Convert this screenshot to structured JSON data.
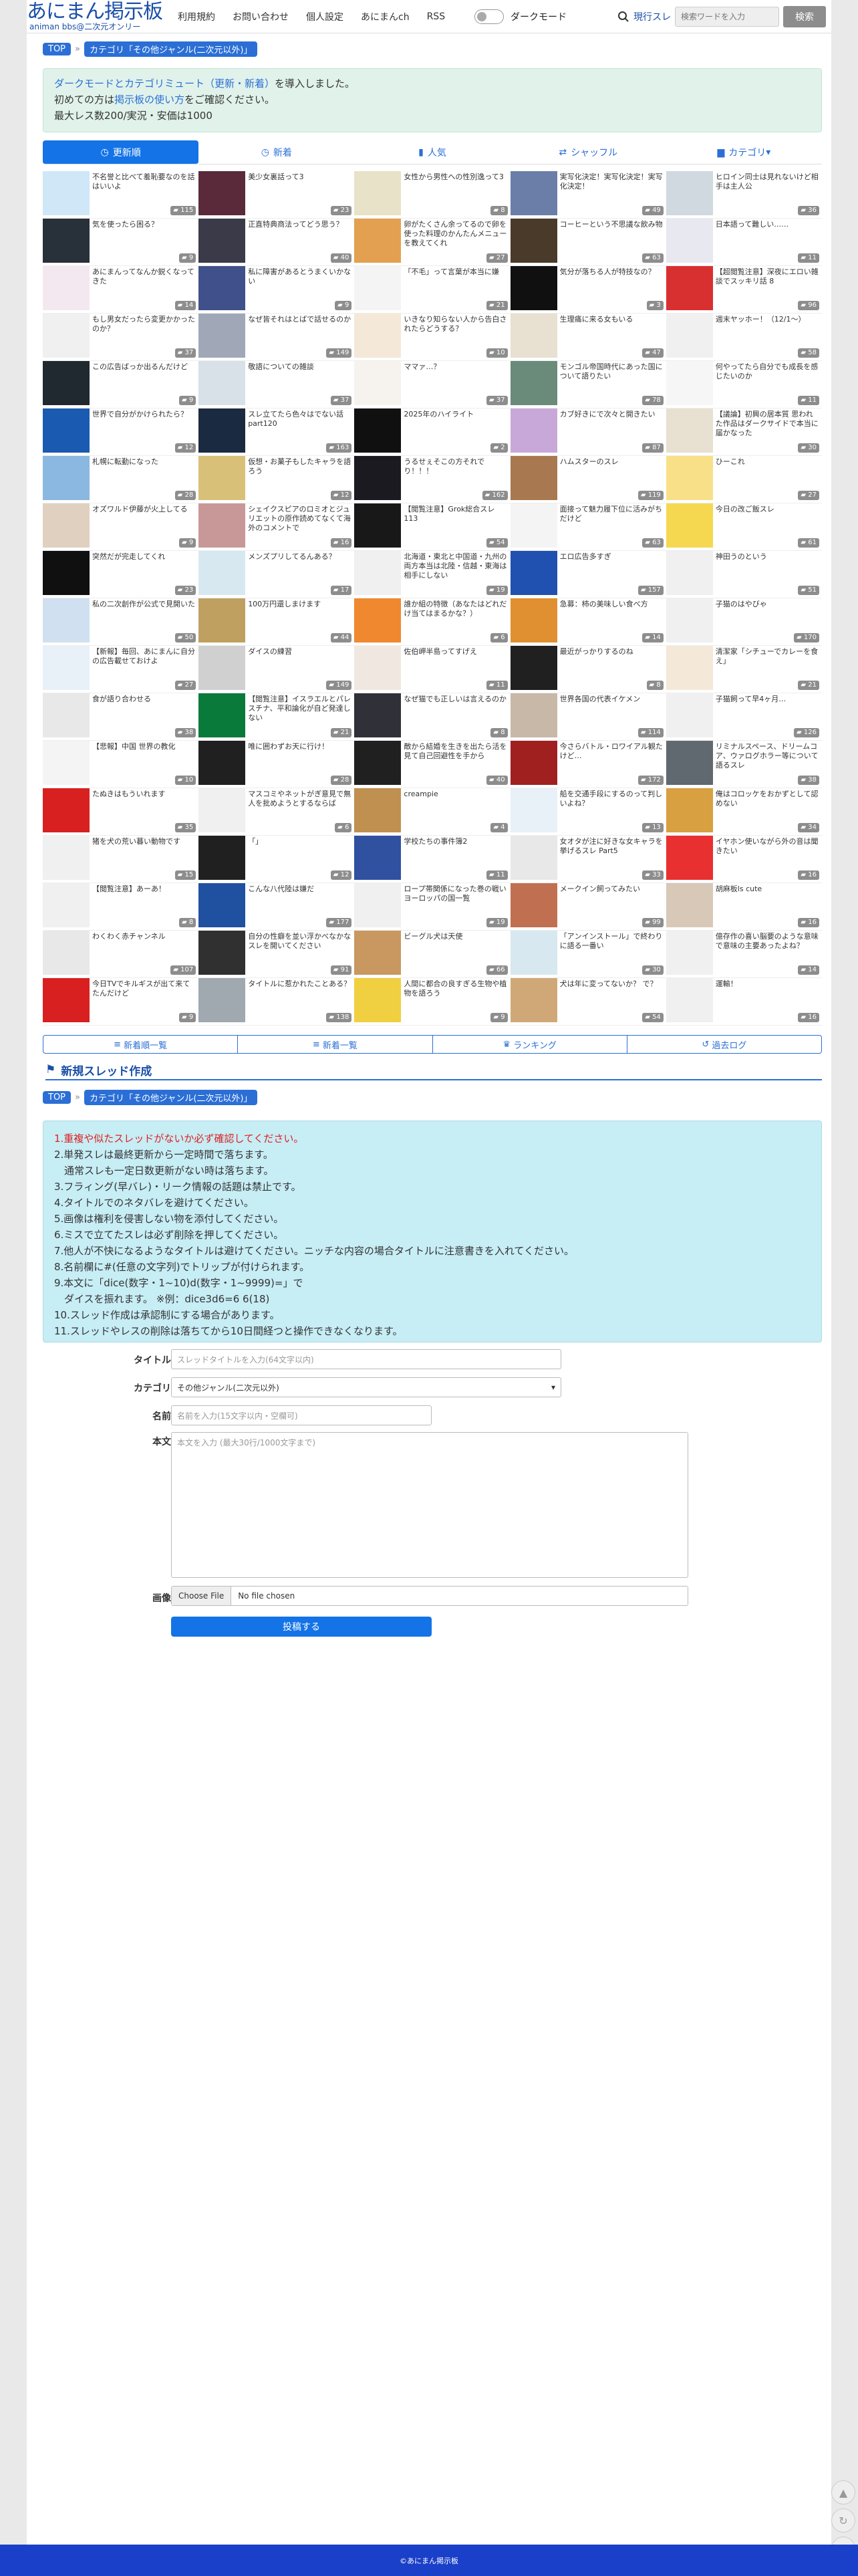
{
  "header": {
    "logo_main": "あにまん掲示板",
    "logo_sub": "animan bbs@二次元オンリー",
    "nav": [
      "利用規約",
      "お問い合わせ",
      "個人設定",
      "あにまんch",
      "RSS"
    ],
    "dark_mode_label": "ダークモード",
    "search_type": "現行スレ",
    "search_placeholder": "検索ワードを入力",
    "search_button": "検索"
  },
  "breadcrumb": {
    "top": "TOP",
    "category": "カテゴリ「その他ジャンル(二次元以外)」"
  },
  "notice": {
    "line1_link": "ダークモードとカテゴリミュート（更新・新着）",
    "line1_rest": "を導入しました。",
    "line2_pre": "初めての方は",
    "line2_link": "掲示板の使い方",
    "line2_post": "をご確認ください。",
    "line3": "最大レス数200/実況・安価は1000"
  },
  "tabs": [
    {
      "label": "更新順",
      "icon": "clock-icon"
    },
    {
      "label": "新着",
      "icon": "clock-icon"
    },
    {
      "label": "人気",
      "icon": "bar-chart-icon"
    },
    {
      "label": "シャッフル",
      "icon": "shuffle-icon"
    },
    {
      "label": "カテゴリ",
      "icon": "folder-icon"
    }
  ],
  "threads": [
    {
      "title": "不名誉と比べて羞恥要なのを話はいいよ",
      "count": "115",
      "color": "#cfe7f7"
    },
    {
      "title": "美少女裏話って3",
      "count": "23",
      "color": "#5a2a3a"
    },
    {
      "title": "女性から男性への性別逸って3",
      "count": "8",
      "color": "#e8e2c8"
    },
    {
      "title": "実写化決定！実写化決定！実写化決定！",
      "count": "49",
      "color": "#6a7ea8"
    },
    {
      "title": "ヒロイン同士は見れないけど相手は主人公",
      "count": "36",
      "color": "#d0d8e0"
    },
    {
      "title": "気を使ったら困る？",
      "count": "9",
      "color": "#28303a"
    },
    {
      "title": "正直特典商法ってどう思う？",
      "count": "40",
      "color": "#3a3a48"
    },
    {
      "title": "卵がたくさん余ってるので卵を使った料理のかんたんメニューを教えてくれ",
      "count": "27",
      "color": "#e3a050"
    },
    {
      "title": "コーヒーという不思議な飲み物",
      "count": "63",
      "color": "#4a3a2a"
    },
    {
      "title": "日本語って難しい……",
      "count": "11",
      "color": "#e8e8f0"
    },
    {
      "title": "あにまんってなんか鋭くなってきた",
      "count": "14",
      "color": "#f4e8f0"
    },
    {
      "title": "私に障害があるとうまくいかない",
      "count": "9",
      "color": "#40508a"
    },
    {
      "title": "「不毛」って言葉が本当に嫌",
      "count": "21",
      "color": "#f4f4f4"
    },
    {
      "title": "気分が落ちる人が特技なの？",
      "count": "3",
      "color": "#101010"
    },
    {
      "title": "【超閲覧注意】深夜にエロい雑談でスッキリ話 8",
      "count": "96",
      "color": "#d83030"
    },
    {
      "title": "もし男女だったら変更かかったのか？",
      "count": "37",
      "color": "#f0f0f0"
    },
    {
      "title": "なぜ皆それはとばで話せるのか",
      "count": "149",
      "color": "#a0a8b8"
    },
    {
      "title": "いきなり知らない人から告白されたらどうする？",
      "count": "10",
      "color": "#f4e8d8"
    },
    {
      "title": "生理痛に来る女もいる",
      "count": "47",
      "color": "#e8e0d0"
    },
    {
      "title": "週末ヤッホー！（12/1～）",
      "count": "58",
      "color": "#f0f0f0"
    },
    {
      "title": "この広告ばっか出るんだけど",
      "count": "9",
      "color": "#202830"
    },
    {
      "title": "敬語についての雑談",
      "count": "37",
      "color": "#d8e0e8"
    },
    {
      "title": "ママァ…？",
      "count": "37",
      "color": "#f6f2ee"
    },
    {
      "title": "モンゴル帝国時代にあった国について語りたい",
      "count": "78",
      "color": "#6a8a7a"
    },
    {
      "title": "何やってたら自分でも成長を感じたいのか",
      "count": "11",
      "color": "#f6f6f6"
    },
    {
      "title": "世界で自分がかけられたら？",
      "count": "12",
      "color": "#1a5ab0"
    },
    {
      "title": "スレ立てたら色々はでない話 part120",
      "count": "163",
      "color": "#1a2a40"
    },
    {
      "title": "2025年のハイライト",
      "count": "2",
      "color": "#101010"
    },
    {
      "title": "カブ好きにで次々と開きたい",
      "count": "87",
      "color": "#c8a8d8"
    },
    {
      "title": "【議論】初興の居本質 思われた作品はダークサイドで本当に届かなった",
      "count": "30",
      "color": "#e8e0d0"
    },
    {
      "title": "札幌に転勤になった",
      "count": "28",
      "color": "#8ab8e0"
    },
    {
      "title": "仮想・お菓子もしたキャラを語ろう",
      "count": "12",
      "color": "#d8c078"
    },
    {
      "title": "うるせぇそこの方それでり！！！",
      "count": "162",
      "color": "#1a1a20"
    },
    {
      "title": "ハムスターのスレ",
      "count": "119",
      "color": "#a87850"
    },
    {
      "title": "ひーこれ",
      "count": "27",
      "color": "#f8e088"
    },
    {
      "title": "オズワルド伊藤が火上してる",
      "count": "9",
      "color": "#e0d0c0"
    },
    {
      "title": "シェイクスピアのロミオとジュリエットの原作読めてなくて海外のコメントで",
      "count": "16",
      "color": "#c89898"
    },
    {
      "title": "【閲覧注意】Grok総合スレ113",
      "count": "54",
      "color": "#181818"
    },
    {
      "title": "面接って魅力履下位に活みがちだけど",
      "count": "63",
      "color": "#f4f4f4"
    },
    {
      "title": "今日の改ご飯スレ",
      "count": "61",
      "color": "#f6d850"
    },
    {
      "title": "突然だが完走してくれ",
      "count": "23",
      "color": "#101010"
    },
    {
      "title": "メンズプリしてるんある？",
      "count": "17",
      "color": "#d8e8f0"
    },
    {
      "title": "北海道・東北と中国道・九州の両方本当は北陸・信越・東海は相手にしない",
      "count": "19",
      "color": "#f0f0f0"
    },
    {
      "title": "エロ広告多すぎ",
      "count": "157",
      "color": "#2050b0"
    },
    {
      "title": "神田うのという",
      "count": "51",
      "color": "#f0f0f0"
    },
    {
      "title": "私の二次創作が公式で見開いた",
      "count": "50",
      "color": "#d0e0f0"
    },
    {
      "title": "100万円還しまけます",
      "count": "44",
      "color": "#c0a060"
    },
    {
      "title": "誰か組の特徴（あなたはどれだけ当てはまるかな？）",
      "count": "6",
      "color": "#f08830"
    },
    {
      "title": "急募：柿の美味しい食べ方",
      "count": "14",
      "color": "#e09030"
    },
    {
      "title": "子猫のはやびゃ",
      "count": "170",
      "color": "#f0f0f0"
    },
    {
      "title": "【新報】毎回、あにまんに自分の広告載せておけよ",
      "count": "27",
      "color": "#e8f0f8"
    },
    {
      "title": "ダイスの練習",
      "count": "149",
      "color": "#d0d0d0"
    },
    {
      "title": "佐伯岬半島ってすげえ",
      "count": "11",
      "color": "#f0e8e0"
    },
    {
      "title": "最近がっかりするのね",
      "count": "8",
      "color": "#202020"
    },
    {
      "title": "清潔家「シチューでカレーを食え」",
      "count": "21",
      "color": "#f4e8d8"
    },
    {
      "title": "食が語り合わせる",
      "count": "38",
      "color": "#e8e8e8"
    },
    {
      "title": "【閲覧注意】イスラエルとパレスチナ、平和論化が自ど発達しない",
      "count": "21",
      "color": "#0a7a3a"
    },
    {
      "title": "なぜ猫でも正しいは言えるのか",
      "count": "8",
      "color": "#303038"
    },
    {
      "title": "世界各国の代表イケメン",
      "count": "114",
      "color": "#c8b8a8"
    },
    {
      "title": "子猫飼って早4ヶ月…",
      "count": "126",
      "color": "#f0f0f0"
    },
    {
      "title": "【悲報】中国 世界の教化",
      "count": "10",
      "color": "#f4f4f4"
    },
    {
      "title": "唯に囲わずお天に行け！",
      "count": "28",
      "color": "#202020"
    },
    {
      "title": "敵から結婚を生きを出たら活を見て自己回避性を手から",
      "count": "40",
      "color": "#202020"
    },
    {
      "title": "今さらバトル・ロワイアル観たけど…",
      "count": "172",
      "color": "#a02020"
    },
    {
      "title": "リミナルスペース、ドリームコア、ウァログホラー等について語るスレ",
      "count": "38",
      "color": "#606870"
    },
    {
      "title": "たぬきはもういれます",
      "count": "35",
      "color": "#d82020"
    },
    {
      "title": "マスコミやネットがぎ意見で無人を批めようとするならば",
      "count": "6",
      "color": "#f0f0f0"
    },
    {
      "title": "creampie",
      "count": "4",
      "color": "#c09050"
    },
    {
      "title": "船を交通手段にするのって判しいよね？",
      "count": "13",
      "color": "#e8f0f8"
    },
    {
      "title": "俺はコロッケをおかずとして認めない",
      "count": "34",
      "color": "#d8a040"
    },
    {
      "title": "猪を犬の荒い暮い動物です",
      "count": "15",
      "color": "#f0f0f0"
    },
    {
      "title": "「」",
      "count": "12",
      "color": "#202020"
    },
    {
      "title": "学校たちの事件簿2",
      "count": "11",
      "color": "#3050a0"
    },
    {
      "title": "女オタが注に好きな女キャラを挙げるスレ Part5",
      "count": "33",
      "color": "#e8e8e8"
    },
    {
      "title": "イヤホン使いながら外の音は聞きたい",
      "count": "16",
      "color": "#e83030"
    },
    {
      "title": "【閲覧注意】あーあ！",
      "count": "8",
      "color": "#f0f0f0"
    },
    {
      "title": "こんな八代陸は嫌だ",
      "count": "177",
      "color": "#2050a0"
    },
    {
      "title": "ロープ帯関係になった巻の戦いヨーロッパの国一覧",
      "count": "19",
      "color": "#f0f0f0"
    },
    {
      "title": "メークイン飼ってみたい",
      "count": "99",
      "color": "#c07050"
    },
    {
      "title": "胡麻板ls cute",
      "count": "16",
      "color": "#d8c8b8"
    },
    {
      "title": "わくわく赤チャンネル",
      "count": "107",
      "color": "#e8e8e8"
    },
    {
      "title": "自分の性癖を並い浮かべなかなスレを開いてください",
      "count": "91",
      "color": "#303030"
    },
    {
      "title": "ビーグル犬は天使",
      "count": "66",
      "color": "#c89860"
    },
    {
      "title": "「アンインストール」で終わりに語る一番い",
      "count": "30",
      "color": "#d8e8f0"
    },
    {
      "title": "億存作の喜い脳要のような意味で意味の主要あったよね？",
      "count": "14",
      "color": "#f0f0f0"
    },
    {
      "title": "今日TVでキルギスが出て来てたんだけど",
      "count": "9",
      "color": "#d82020"
    },
    {
      "title": "タイトルに惹かれたことある？",
      "count": "138",
      "color": "#a0a8b0"
    },
    {
      "title": "人間に都合の良すぎる生物や植物を語ろう",
      "count": "9",
      "color": "#f0d040"
    },
    {
      "title": "犬は年に変ってないか？ で？",
      "count": "54",
      "color": "#d0a878"
    },
    {
      "title": "運輸！",
      "count": "16",
      "color": "#f0f0f0"
    }
  ],
  "bottom_tabs": [
    {
      "label": "新着順一覧",
      "icon": "list-icon"
    },
    {
      "label": "新着一覧",
      "icon": "list-icon"
    },
    {
      "label": "ランキング",
      "icon": "trophy-icon"
    },
    {
      "label": "過去ログ",
      "icon": "history-icon"
    }
  ],
  "new_thread": {
    "heading": "新規スレッド作成",
    "rules": [
      {
        "text": "1.重複や似たスレッドがないか必ず確認してください。",
        "red": true
      },
      {
        "text": "2.単発スレは最終更新から一定時間で落ちます。",
        "red": false
      },
      {
        "text": "　通常スレも一定日数更新がない時は落ちます。",
        "red": false
      },
      {
        "text": "3.フラィング(早バレ)・リーク情報の話題は禁止です。",
        "red": false
      },
      {
        "text": "4.タイトルでのネタバレを避けてください。",
        "red": false
      },
      {
        "text": "5.画像は権利を侵害しない物を添付してください。",
        "red": false
      },
      {
        "text": "6.ミスで立てたスレは必ず削除を押してください。",
        "red": false
      },
      {
        "text": "7.他人が不快になるようなタイトルは避けてください。ニッチな内容の場合タイトルに注意書きを入れてください。",
        "red": false
      },
      {
        "text": "8.名前欄に#(任意の文字列)でトリップが付けられます。",
        "red": false
      },
      {
        "text": "9.本文に「dice(数字・1~10)d(数字・1~9999)=」で",
        "red": false
      },
      {
        "text": "　ダイスを振れます。 ※例：dice3d6=6 6(18)",
        "red": false
      },
      {
        "text": "10.スレッド作成は承認制にする場合があります。",
        "red": false
      },
      {
        "text": "11.スレッドやレスの削除は落ちてから10日間経つと操作できなくなります。",
        "red": false
      }
    ],
    "title_label": "タイトル",
    "title_placeholder": "スレッドタイトルを入力(64文字以内)",
    "category_label": "カテゴリ",
    "category_value": "その他ジャンル(二次元以外)",
    "name_label": "名前",
    "name_placeholder": "名前を入力(15文字以内・空欄可)",
    "body_label": "本文",
    "body_placeholder": "本文を入力 (最大30行/1000文字まで)",
    "image_label": "画像",
    "file_button": "Choose File",
    "file_status": "No file chosen",
    "submit": "投稿する"
  },
  "footer": "©あにまん掲示板",
  "colors": {
    "brand": "#1a4fa8",
    "accent": "#1473e6",
    "notice_bg": "#e0f2ea",
    "rules_bg": "#c7edf5",
    "footer": "#1a3fc8"
  }
}
